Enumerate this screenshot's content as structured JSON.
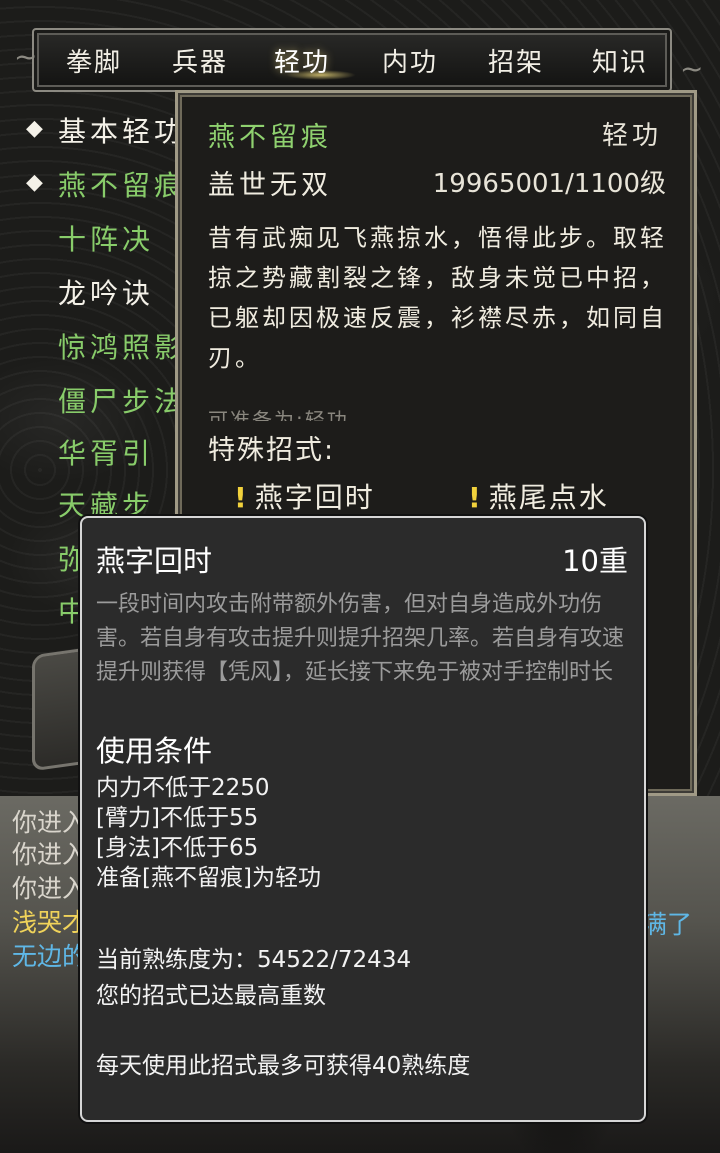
{
  "tabs": [
    "拳脚",
    "兵器",
    "轻功",
    "内功",
    "招架",
    "知识"
  ],
  "active_tab": "轻功",
  "skill_list": [
    {
      "label": "基本轻功",
      "color": "white",
      "marked": true
    },
    {
      "label": "燕不留痕",
      "color": "green",
      "marked": true
    },
    {
      "label": "十阵决",
      "color": "green",
      "marked": false
    },
    {
      "label": "龙吟诀",
      "color": "white",
      "marked": false
    },
    {
      "label": "惊鸿照影",
      "color": "green",
      "marked": false
    },
    {
      "label": "僵尸步法",
      "color": "green",
      "marked": false
    },
    {
      "label": "华胥引",
      "color": "green",
      "marked": false
    },
    {
      "label": "天藏步",
      "color": "green",
      "marked": false
    },
    {
      "label": "弥",
      "color": "green",
      "marked": false
    },
    {
      "label": "中",
      "color": "green",
      "marked": false
    }
  ],
  "detail": {
    "name": "燕不留痕",
    "type": "轻功",
    "rank": "盖世无双",
    "level": "19965001/1100级",
    "description": "昔有武痴见飞燕掠水，悟得此步。取轻掠之势藏割裂之锋，敌身未觉已中招，已躯却因极速反震，衫襟尽赤，如同自刃。",
    "equip_hint": "可准备为:轻功",
    "special_label": "特殊招式:",
    "moves": [
      "燕字回时",
      "燕尾点水"
    ]
  },
  "tooltip": {
    "name": "燕字回时",
    "tier": "10重",
    "description": "一段时间内攻击附带额外伤害，但对自身造成外功伤害。若自身有攻击提升则提升招架几率。若自身有攻速提升则获得【凭风】，延长接下来免于被对手控制时长",
    "requirements_title": "使用条件",
    "requirements": [
      "内力不低于2250",
      "[臂力]不低于55",
      "[身法]不低于65",
      "准备[燕不留痕]为轻功"
    ],
    "proficiency": "当前熟练度为：54522/72434",
    "max_tier_note": "您的招式已达最高重数",
    "daily_note": "每天使用此招式最多可获得40熟练度"
  },
  "log": [
    {
      "text": "你进入",
      "color": "grey"
    },
    {
      "text": "你进入",
      "color": "grey"
    },
    {
      "text": "你进入",
      "color": "grey"
    },
    {
      "text": "浅哭才",
      "color": "yellow"
    },
    {
      "text": "无边的",
      "color": "blue"
    }
  ],
  "log_right": "满了"
}
